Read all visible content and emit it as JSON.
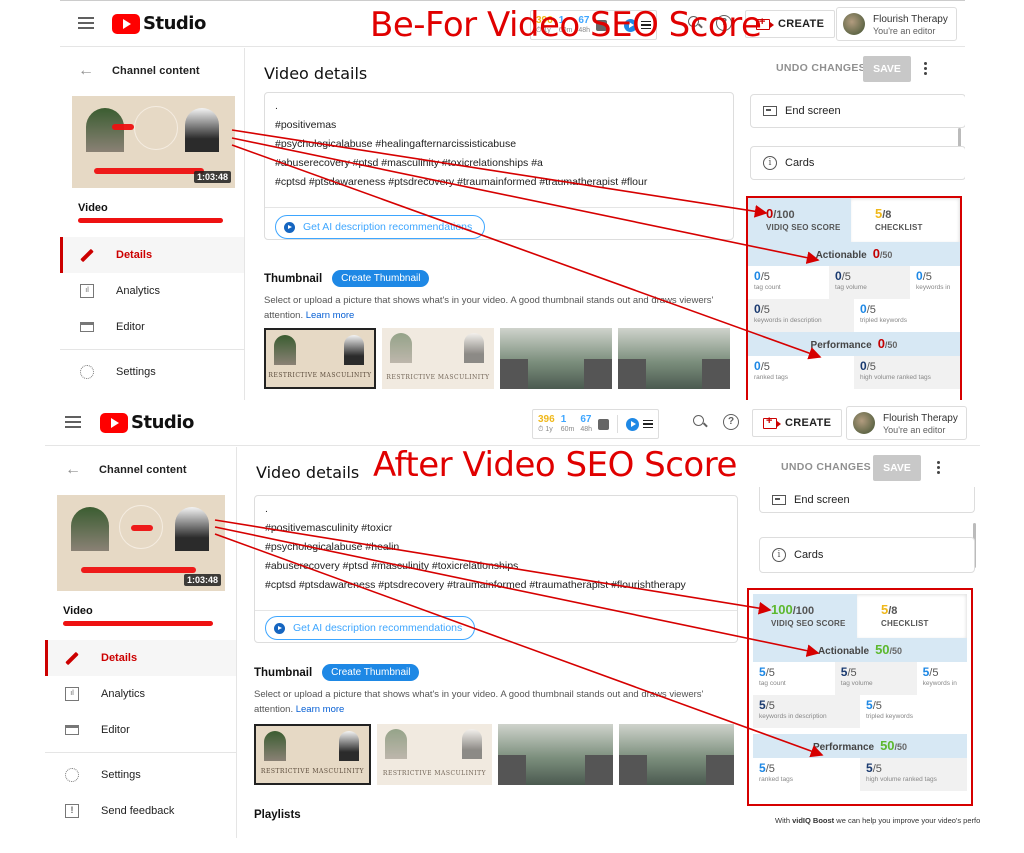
{
  "app": {
    "logo_text": "Studio",
    "create_label": "CREATE",
    "account_name": "Flourish Therapy",
    "account_role": "You're an editor"
  },
  "vidiq_bar": {
    "stat1_value": "396",
    "stat1_label": "⏱ 1y",
    "stat2_value": "1",
    "stat2_label": "60m",
    "stat3_value": "67",
    "stat3_label": "48h"
  },
  "sidebar": {
    "back_label": "Channel content",
    "duration": "1:03:48",
    "video_label": "Video",
    "nav": [
      {
        "label": "Details",
        "icon": "pencil-icon"
      },
      {
        "label": "Analytics",
        "icon": "analytics-icon"
      },
      {
        "label": "Editor",
        "icon": "editor-icon"
      },
      {
        "label": "Settings",
        "icon": "gear-icon"
      },
      {
        "label": "Send feedback",
        "icon": "feedback-icon"
      }
    ]
  },
  "main": {
    "page_title": "Video details",
    "description_lines_before": [
      ".",
      "#positivemas",
      "#psychologicalabuse #healingafternarcissisticabuse",
      "#abuserecovery #ptsd #masculinity #toxicrelationships #a",
      "#cptsd #ptsdawareness #ptsdrecovery #traumainformed #traumatherapist #flour"
    ],
    "description_lines_after": [
      ".",
      "#positivemasculinity #toxicr",
      "#psychologicalabuse #healin",
      "#abuserecovery #ptsd #masculinity #toxicrelationships",
      "#cptsd #ptsdawareness #ptsdrecovery #traumainformed #traumatherapist #flourishtherapy"
    ],
    "ai_button": "Get AI description recommendations",
    "thumbnail_label": "Thumbnail",
    "create_thumbnail": "Create Thumbnail",
    "thumbnail_help": "Select or upload a picture that shows what's in your video. A good thumbnail stands out and draws viewers' attention.",
    "learn_more": "Learn more",
    "thumb_caption": "RESTRICTIVE MASCULINITY",
    "playlists_label": "Playlists"
  },
  "right": {
    "undo_label": "UNDO CHANGES",
    "save_label": "SAVE",
    "end_screen": "End screen",
    "cards": "Cards",
    "boost_prefix": "With ",
    "boost_brand": "vidIQ Boost",
    "boost_suffix": " we can help you improve your video's perfo"
  },
  "annotations": {
    "before_title": "Be-For Video SEO Score",
    "after_title": "After Video SEO Score"
  },
  "seo_before": {
    "score": "0",
    "score_max": "/100",
    "score_label": "VIDIQ SEO SCORE",
    "checklist": "5",
    "checklist_max": "/8",
    "checklist_label": "CHECKLIST",
    "actionable_label": "Actionable",
    "actionable": "0",
    "actionable_max": "/50",
    "performance_label": "Performance",
    "performance": "0",
    "performance_max": "/50",
    "metrics": [
      {
        "value": "0",
        "max": "/5",
        "label": "tag count"
      },
      {
        "value": "0",
        "max": "/5",
        "label": "tag volume"
      },
      {
        "value": "0",
        "max": "/5",
        "label": "keywords in"
      },
      {
        "value": "0",
        "max": "/5",
        "label": "keywords in description"
      },
      {
        "value": "0",
        "max": "/5",
        "label": "tripled keywords"
      },
      {
        "value": "0",
        "max": "/5",
        "label": "ranked tags"
      },
      {
        "value": "0",
        "max": "/5",
        "label": "high volume ranked tags"
      }
    ]
  },
  "seo_after": {
    "score": "100",
    "score_max": "/100",
    "score_label": "VIDIQ SEO SCORE",
    "checklist": "5",
    "checklist_max": "/8",
    "checklist_label": "CHECKLIST",
    "actionable_label": "Actionable",
    "actionable": "50",
    "actionable_max": "/50",
    "performance_label": "Performance",
    "performance": "50",
    "performance_max": "/50",
    "metrics": [
      {
        "value": "5",
        "max": "/5",
        "label": "tag count"
      },
      {
        "value": "5",
        "max": "/5",
        "label": "tag volume"
      },
      {
        "value": "5",
        "max": "/5",
        "label": "keywords in"
      },
      {
        "value": "5",
        "max": "/5",
        "label": "keywords in description"
      },
      {
        "value": "5",
        "max": "/5",
        "label": "tripled keywords"
      },
      {
        "value": "5",
        "max": "/5",
        "label": "ranked tags"
      },
      {
        "value": "5",
        "max": "/5",
        "label": "high volume ranked tags"
      }
    ]
  }
}
